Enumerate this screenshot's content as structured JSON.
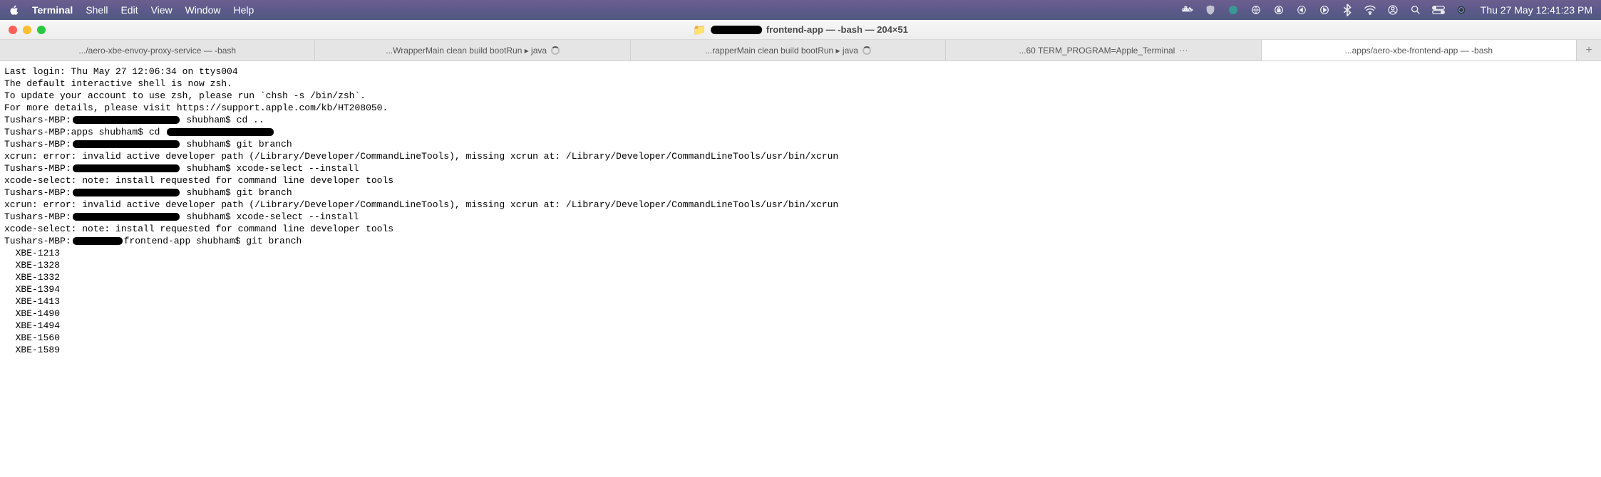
{
  "menubar": {
    "app_name": "Terminal",
    "items": [
      "Shell",
      "Edit",
      "View",
      "Window",
      "Help"
    ],
    "clock": "Thu 27 May  12:41:23 PM"
  },
  "titlebar": {
    "title_suffix": "frontend-app — -bash — 204×51"
  },
  "tabs": [
    {
      "label": ".../aero-xbe-envoy-proxy-service — -bash",
      "spinner": false,
      "more": false
    },
    {
      "label": "...WrapperMain clean build bootRun ▸ java",
      "spinner": true,
      "more": false
    },
    {
      "label": "...rapperMain clean build bootRun ▸ java",
      "spinner": true,
      "more": false
    },
    {
      "label": "...60 TERM_PROGRAM=Apple_Terminal",
      "spinner": false,
      "more": true
    },
    {
      "label": "...apps/aero-xbe-frontend-app — -bash",
      "spinner": false,
      "more": false,
      "active": true
    }
  ],
  "terminal": {
    "lines": [
      "Last login: Thu May 27 12:06:34 on ttys004",
      "",
      "The default interactive shell is now zsh.",
      "To update your account to use zsh, please run `chsh -s /bin/zsh`.",
      "For more details, please visit https://support.apple.com/kb/HT208050."
    ],
    "prompt_lines": [
      {
        "pre": "Tushars-MBP:",
        "redact_class": "r1",
        "post": " shubham$ cd .."
      },
      {
        "pre": "Tushars-MBP:apps shubham$ cd ",
        "redact_class": "r2",
        "post": ""
      },
      {
        "pre": "Tushars-MBP:",
        "redact_class": "r3",
        "post": " shubham$ git branch"
      },
      {
        "plain": "xcrun: error: invalid active developer path (/Library/Developer/CommandLineTools), missing xcrun at: /Library/Developer/CommandLineTools/usr/bin/xcrun"
      },
      {
        "pre": "Tushars-MBP:",
        "redact_class": "r4",
        "post": " shubham$ xcode-select --install"
      },
      {
        "plain": "xcode-select: note: install requested for command line developer tools"
      },
      {
        "pre": "Tushars-MBP:",
        "redact_class": "r5",
        "post": " shubham$ git branch"
      },
      {
        "plain": "xcrun: error: invalid active developer path (/Library/Developer/CommandLineTools), missing xcrun at: /Library/Developer/CommandLineTools/usr/bin/xcrun"
      },
      {
        "pre": "Tushars-MBP:",
        "redact_class": "r6",
        "post": " shubham$ xcode-select --install"
      },
      {
        "plain": "xcode-select: note: install requested for command line developer tools"
      },
      {
        "pre": "Tushars-MBP:",
        "redact_class": "r7",
        "post": "frontend-app shubham$ git branch"
      }
    ],
    "branches": [
      "  XBE-1213",
      "  XBE-1328",
      "  XBE-1332",
      "  XBE-1394",
      "  XBE-1413",
      "  XBE-1490",
      "  XBE-1494",
      "  XBE-1560",
      "  XBE-1589"
    ]
  }
}
